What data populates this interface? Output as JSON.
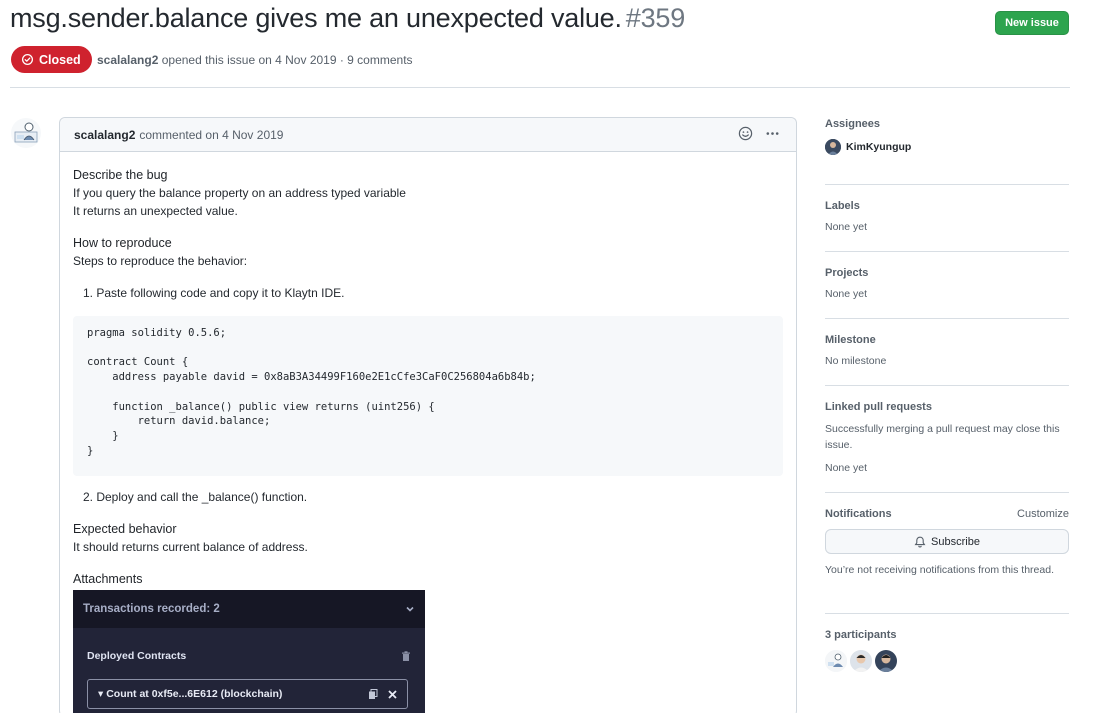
{
  "issue": {
    "title": "msg.sender.balance gives me an unexpected value.",
    "number": "#359",
    "state": "Closed",
    "author": "scalalang2",
    "opened_text": "opened this issue on 4 Nov 2019 · 9 comments"
  },
  "header": {
    "new_issue_label": "New issue"
  },
  "comment": {
    "author": "scalalang2",
    "meta": "commented on 4 Nov 2019",
    "bug_heading": "Describe the bug",
    "bug_line1": "If you query the balance property on an address typed variable",
    "bug_line2": "It returns an unexpected value.",
    "repro_heading": "How to reproduce",
    "repro_line": "Steps to reproduce the behavior:",
    "step1": "1. Paste following code and copy it to Klaytn IDE.",
    "code": "pragma solidity 0.5.6;\n\ncontract Count {\n    address payable david = 0x8aB3A34499F160e2E1cCfe3CaF0C256804a6b84b;\n\n    function _balance() public view returns (uint256) {\n        return david.balance;\n    }\n}",
    "step2": "2. Deploy and call the _balance() function.",
    "expected_heading": "Expected behavior",
    "expected_line": "It should returns current balance of address.",
    "attachments_heading": "Attachments",
    "attachment": {
      "tx_recorded": "Transactions recorded: 2",
      "deployed": "Deployed Contracts",
      "count": "Count at 0xf5e...6E612 (blockchain)"
    }
  },
  "sidebar": {
    "assignees_heading": "Assignees",
    "assignee": "KimKyungup",
    "labels_heading": "Labels",
    "labels_value": "None yet",
    "projects_heading": "Projects",
    "projects_value": "None yet",
    "milestone_heading": "Milestone",
    "milestone_value": "No milestone",
    "linked_heading": "Linked pull requests",
    "linked_desc": "Successfully merging a pull request may close this issue.",
    "linked_value": "None yet",
    "notifications_heading": "Notifications",
    "customize_label": "Customize",
    "subscribe_label": "Subscribe",
    "notifications_desc": "You’re not receiving notifications from this thread.",
    "participants_heading": "3 participants"
  },
  "colors": {
    "closed_red": "#cf222e",
    "new_issue_green": "#2da44e",
    "attachment_bg": "#222438"
  }
}
